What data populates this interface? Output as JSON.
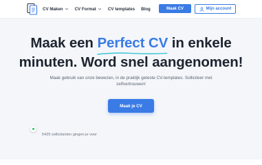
{
  "header": {
    "logo_icon": "document-stack-logo-icon",
    "nav": [
      {
        "label": "CV Maken",
        "has_dropdown": true
      },
      {
        "label": "CV Format",
        "has_dropdown": true
      },
      {
        "label": "CV templates",
        "has_dropdown": false
      },
      {
        "label": "Blog",
        "has_dropdown": false
      }
    ],
    "primary_button": "Maak CV",
    "account_button": "Mijn account",
    "account_icon": "user-icon"
  },
  "hero": {
    "headline_part1": "Maak een",
    "headline_highlight": "Perfect CV",
    "headline_part2": "in enkele",
    "headline_line2": "minuten. Word snel aangenomen!",
    "subtext": "Maak gebruik van onze bewezen, in de praktijk geteste CV-templates. Solliciteer met zelfvertrouwen!",
    "cta_label": "Maak je CV",
    "applicants_text": "5425 sollicitanten gingen je voor",
    "status_indicator": "online-status-dot-icon"
  },
  "colors": {
    "accent": "#3a7be5",
    "highlight_underline": "#38c5d6",
    "hero_background": "#f4f6f9",
    "status_green": "#22c55e"
  }
}
